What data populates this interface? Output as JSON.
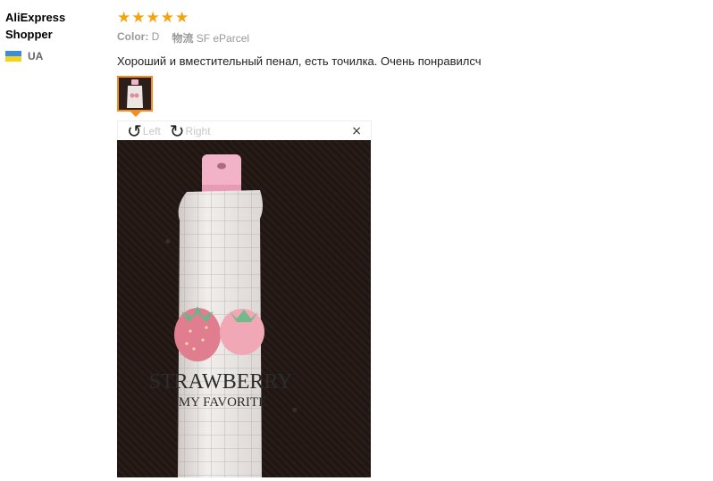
{
  "user": {
    "name": "AliExpress\nShopper",
    "country_code": "UA"
  },
  "review": {
    "stars": 5,
    "color_label": "Color:",
    "color_value": "D",
    "shipping_label": "物流",
    "shipping_value": "SF eParcel",
    "text": "Хороший и вместительный пенал, есть точилка. Очень понравилсч"
  },
  "viewer": {
    "rotate_left_label": "Left",
    "rotate_right_label": "Right",
    "close_symbol": "×",
    "photo_text_line1": "STRAWBERRY",
    "photo_text_line2": "MY FAVORITE"
  },
  "colors": {
    "accent": "#f68b1e",
    "star": "#f7a20a"
  }
}
